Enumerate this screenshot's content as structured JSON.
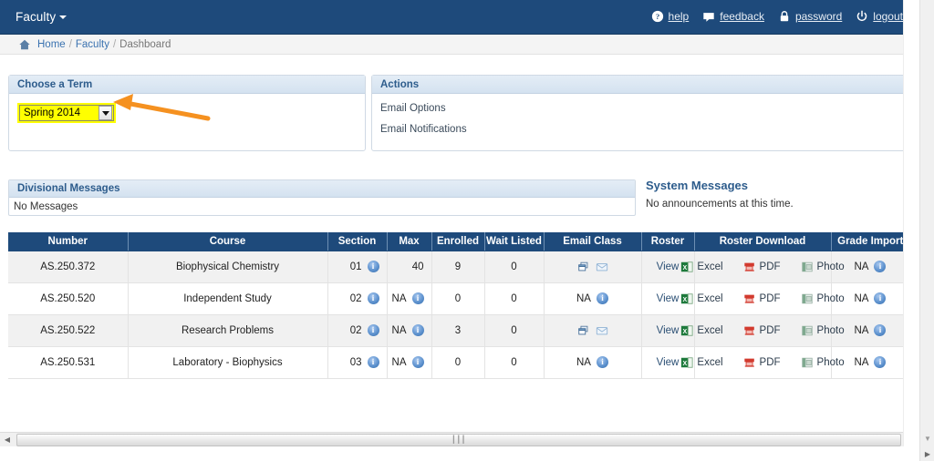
{
  "navbar": {
    "brand": "Faculty",
    "links": [
      {
        "label": "help",
        "icon": "question-circle-icon"
      },
      {
        "label": "feedback",
        "icon": "comment-icon"
      },
      {
        "label": "password",
        "icon": "lock-icon"
      },
      {
        "label": "logout",
        "icon": "power-icon"
      }
    ]
  },
  "breadcrumb": {
    "home": "Home",
    "sep": "/",
    "section": "Faculty",
    "current": "Dashboard"
  },
  "term_panel": {
    "title": "Choose a Term",
    "selected_term": "Spring 2014",
    "highlight_color": "#ffff00",
    "annotation_arrow_color": "#f59120"
  },
  "actions_panel": {
    "title": "Actions",
    "links": [
      "Email Options",
      "Email Notifications"
    ]
  },
  "divisional_messages": {
    "title": "Divisional Messages",
    "body": "No Messages"
  },
  "system_messages": {
    "title": "System Messages",
    "body": "No announcements at this time."
  },
  "table": {
    "columns": [
      "Number",
      "Course",
      "Section",
      "Max",
      "Enrolled",
      "Wait Listed",
      "Email Class",
      "Roster",
      "Roster Download",
      "Grade Import"
    ],
    "download_labels": {
      "excel": "Excel",
      "pdf": "PDF",
      "photo": "Photo"
    },
    "roster_label": "View",
    "na_label": "NA",
    "rows": [
      {
        "number": "AS.250.372",
        "course": "Biophysical Chemistry",
        "section": "01",
        "section_info": true,
        "max": "40",
        "max_info": false,
        "enrolled": "9",
        "wait_listed": "0",
        "email_class": "icons",
        "roster": "View",
        "grade_import": "NA"
      },
      {
        "number": "AS.250.520",
        "course": "Independent Study",
        "section": "02",
        "section_info": true,
        "max": "NA",
        "max_info": true,
        "enrolled": "0",
        "wait_listed": "0",
        "email_class": "NA",
        "roster": "View",
        "grade_import": "NA"
      },
      {
        "number": "AS.250.522",
        "course": "Research Problems",
        "section": "02",
        "section_info": true,
        "max": "NA",
        "max_info": true,
        "enrolled": "3",
        "wait_listed": "0",
        "email_class": "icons",
        "roster": "View",
        "grade_import": "NA"
      },
      {
        "number": "AS.250.531",
        "course": "Laboratory - Biophysics",
        "section": "03",
        "section_info": true,
        "max": "NA",
        "max_info": true,
        "enrolled": "0",
        "wait_listed": "0",
        "email_class": "NA",
        "roster": "View",
        "grade_import": "NA"
      }
    ]
  },
  "colors": {
    "navy": "#1e4a7b",
    "panel_header_blue": "#2d5c8c",
    "link_blue": "#3a72b0"
  }
}
